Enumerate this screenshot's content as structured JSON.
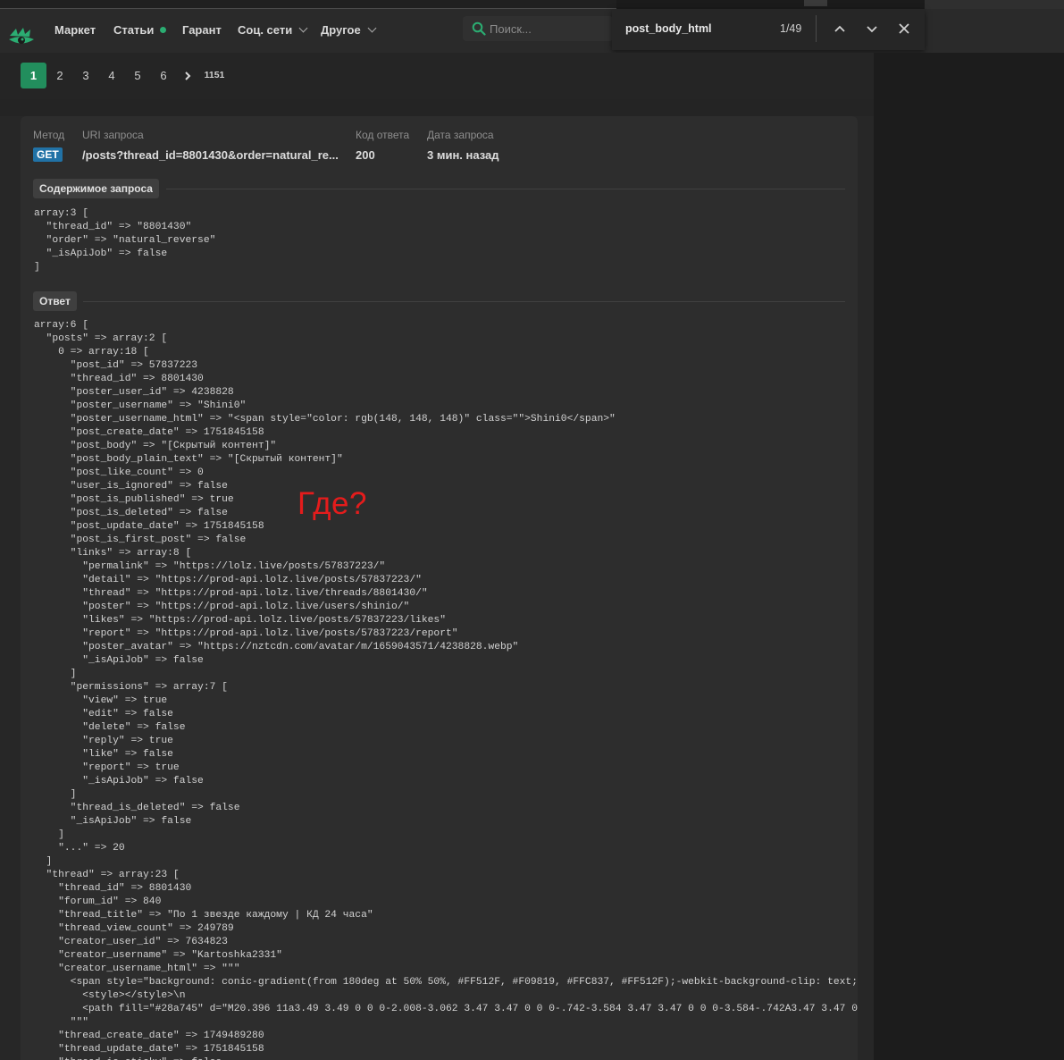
{
  "nav": {
    "items": [
      {
        "label": "Маркет"
      },
      {
        "label": "Статьи"
      },
      {
        "label": "Гарант"
      },
      {
        "label": "Соц. сети"
      },
      {
        "label": "Другое"
      }
    ],
    "search_placeholder": "Поиск..."
  },
  "find": {
    "query": "post_body_html",
    "count": "1/49"
  },
  "pagination": {
    "pages": [
      "1",
      "2",
      "3",
      "4",
      "5",
      "6"
    ],
    "last": "1151",
    "current": "1"
  },
  "request": {
    "method_label": "Метод",
    "uri_label": "URI запроса",
    "code_label": "Код ответа",
    "date_label": "Дата запроса",
    "method": "GET",
    "uri": "/posts?thread_id=8801430&order=natural_re...",
    "code": "200",
    "date": "3 мин. назад"
  },
  "sections": {
    "request_body": "Содержимое запроса",
    "response": "Ответ"
  },
  "request_body": "array:3 [\n  \"thread_id\" => \"8801430\"\n  \"order\" => \"natural_reverse\"\n  \"_isApiJob\" => false\n]",
  "response_body": "array:6 [\n  \"posts\" => array:2 [\n    0 => array:18 [\n      \"post_id\" => 57837223\n      \"thread_id\" => 8801430\n      \"poster_user_id\" => 4238828\n      \"poster_username\" => \"Shini0\"\n      \"poster_username_html\" => \"<span style=\"color: rgb(148, 148, 148)\" class=\"\">Shini0</span>\"\n      \"post_create_date\" => 1751845158\n      \"post_body\" => \"[Скрытый контент]\"\n      \"post_body_plain_text\" => \"[Скрытый контент]\"\n      \"post_like_count\" => 0\n      \"user_is_ignored\" => false\n      \"post_is_published\" => true\n      \"post_is_deleted\" => false\n      \"post_update_date\" => 1751845158\n      \"post_is_first_post\" => false\n      \"links\" => array:8 [\n        \"permalink\" => \"https://lolz.live/posts/57837223/\"\n        \"detail\" => \"https://prod-api.lolz.live/posts/57837223/\"\n        \"thread\" => \"https://prod-api.lolz.live/threads/8801430/\"\n        \"poster\" => \"https://prod-api.lolz.live/users/shinio/\"\n        \"likes\" => \"https://prod-api.lolz.live/posts/57837223/likes\"\n        \"report\" => \"https://prod-api.lolz.live/posts/57837223/report\"\n        \"poster_avatar\" => \"https://nztcdn.com/avatar/m/1659043571/4238828.webp\"\n        \"_isApiJob\" => false\n      ]\n      \"permissions\" => array:7 [\n        \"view\" => true\n        \"edit\" => false\n        \"delete\" => false\n        \"reply\" => true\n        \"like\" => false\n        \"report\" => true\n        \"_isApiJob\" => false\n      ]\n      \"thread_is_deleted\" => false\n      \"_isApiJob\" => false\n    ]\n    \"...\" => 20\n  ]\n  \"thread\" => array:23 [\n    \"thread_id\" => 8801430\n    \"forum_id\" => 840\n    \"thread_title\" => \"По 1 звезде каждому | КД 24 часа\"\n    \"thread_view_count\" => 249789\n    \"creator_user_id\" => 7634823\n    \"creator_username\" => \"Kartoshka2331\"\n    \"creator_username_html\" => \"\"\"\n      <span style=\"background: conic-gradient(from 180deg at 50% 50%, #FF512F, #F09819, #FFC837, #FF512F);-webkit-background-clip: text;-webkit-text-fill-color: transparent;\">\n        <style></style>\\n\n        <path fill=\"#28a745\" d=\"M20.396 11a3.49 3.49 0 0 0-2.008-3.062 3.47 3.47 0 0 0-.742-3.584 3.47 3.47 0 0 0-3.584-.742A3.47 3.47 0 0 0 11 1.604a3.46 …\n      \"\"\"\n    \"thread_create_date\" => 1749489280\n    \"thread_update_date\" => 1751845158\n    \"thread_is_sticky\" => false",
  "annotation": "Где?"
}
